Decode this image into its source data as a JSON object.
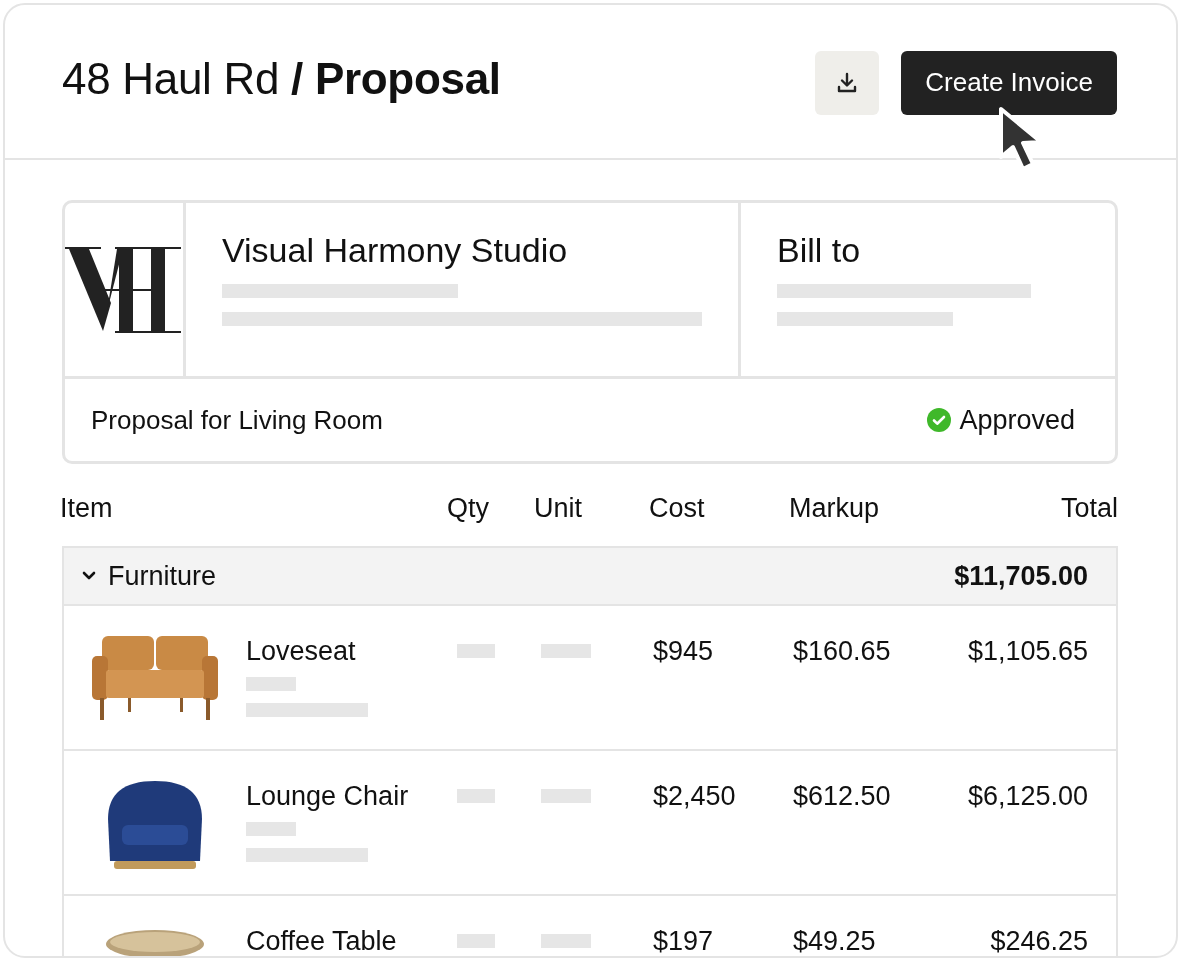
{
  "header": {
    "title": "48 Haul Rd **/ Proposal**",
    "buttons": [
      {
        "kind": "download"
      },
      {
        "kind": "primary",
        "label": "Create Invoice"
      }
    ]
  },
  "info_card": {
    "studio": "Visual Harmony Studio",
    "bill_to": "Bill to",
    "proposal": "Proposal for Living Room",
    "status": {
      "label": "Approved",
      "approved": true
    }
  },
  "table": {
    "columns": [
      "Item",
      "Qty",
      "Unit",
      "Cost",
      "Markup",
      "Total"
    ],
    "groups": [
      {
        "name": "Furniture",
        "expanded": true,
        "total": "$11,705.00",
        "rows": [
          {
            "kind": "sofa",
            "name": "Loveseat",
            "cost": "$945",
            "markup": "$160.65",
            "total": "$1,105.65"
          },
          {
            "kind": "armchair",
            "name": "Lounge Chair",
            "cost": "$2,450",
            "markup": "$612.50",
            "total": "$6,125.00"
          },
          {
            "kind": "table",
            "name": "Coffee Table",
            "cost": "$197",
            "markup": "$49.25",
            "total": "$246.25"
          }
        ]
      }
    ]
  }
}
